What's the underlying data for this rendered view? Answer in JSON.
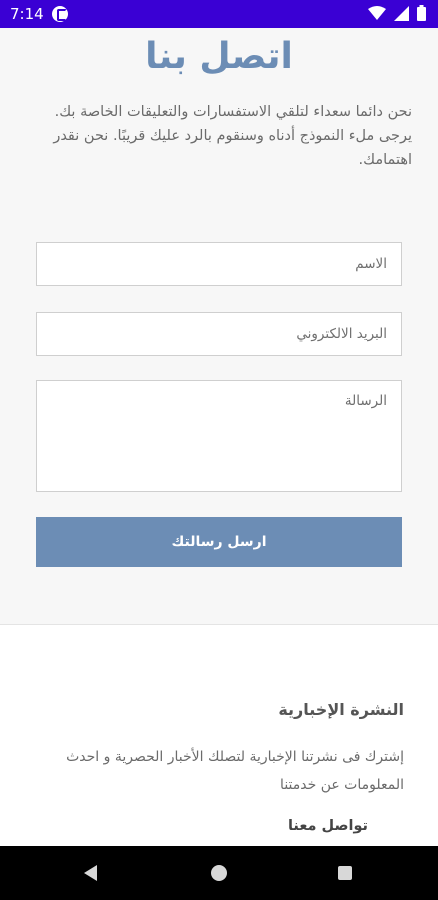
{
  "status_bar": {
    "time": "7:14",
    "icons": [
      "notification-icon",
      "wifi-icon",
      "signal-icon",
      "battery-icon"
    ]
  },
  "contact": {
    "title": "اتصل بنا",
    "intro": "نحن دائما سعداء لتلقي الاستفسارات والتعليقات الخاصة بك. يرجى ملء النموذج أدناه وسنقوم بالرد عليك قريبًا. نحن نقدر اهتمامك.",
    "name_placeholder": "الاسم",
    "email_placeholder": "البريد الالكتروني",
    "message_placeholder": "الرسالة",
    "send_label": "ارسل رسالتك"
  },
  "newsletter": {
    "title": "النشرة الإخبارية",
    "text": "إشترك فى نشرتنا الإخبارية لتصلك الأخبار الحصرية و احدث المعلومات عن خدمتنا"
  },
  "footer": {
    "contact_label": "تواصل معنا"
  },
  "colors": {
    "status_bar": "#3a00d4",
    "accent": "#6c8db5",
    "navbar": "#000000"
  },
  "nav_bar": {
    "icons": [
      "back-icon",
      "home-icon",
      "recents-icon"
    ]
  }
}
